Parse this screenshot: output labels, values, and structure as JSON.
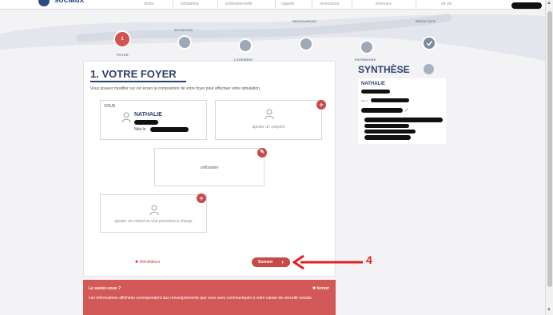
{
  "nav": {
    "logo": "sociaux",
    "items": [
      "droits",
      "simulateur",
      "professionnelle",
      "rappels",
      "ressources",
      "d'erreurs",
      "de vie"
    ]
  },
  "steps": [
    {
      "num": "1",
      "label": "FOYER",
      "active": true
    },
    {
      "num": "",
      "label": "SITUATION"
    },
    {
      "num": "",
      "label": "LOGEMENT"
    },
    {
      "num": "",
      "label": "RESSOURCES"
    },
    {
      "num": "",
      "label": "PATRIMOINE"
    },
    {
      "num": "",
      "label": "RÉSULTATS"
    }
  ],
  "main": {
    "title": "1. VOTRE FOYER",
    "description": "Vous pouvez modifier sur cet écran la composition de votre foyer pour effectuer votre simulation.",
    "vous_label": "VOUS",
    "person_name": "NATHALIE",
    "nee_label": "Née le",
    "add_spouse": "ajouter un conjoint",
    "status": "célibataire",
    "add_child": "ajouter un enfant ou une personne à charge",
    "reset": "Réinitialiser",
    "next": "Suivant"
  },
  "annotation": {
    "number": "4",
    "color": "#e02020"
  },
  "info": {
    "title": "Le saviez-vous ?",
    "close": "fermer",
    "text": "Les informations affichées correspondent aux renseignements que vous avez communiqués à votre caisse de sécurité sociale."
  },
  "synthese": {
    "title": "SYNTHÈSE",
    "name": "NATHALIE",
    "small_label": "Née le"
  },
  "colors": {
    "accent": "#c94848",
    "primary": "#2c3e6b",
    "step_inactive": "#9fa8b6"
  }
}
